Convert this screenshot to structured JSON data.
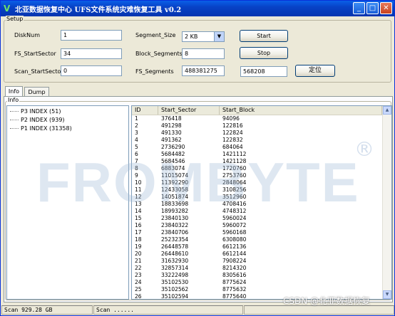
{
  "window": {
    "title": "北亚数据恢复中心 UFS文件系统灾难恢复工具 v0.2",
    "minimize": "_",
    "maximize": "□",
    "close": "✕"
  },
  "setup": {
    "group_label": "Setup",
    "disknum_label": "DiskNum",
    "disknum_value": "1",
    "fs_startsector_label": "FS_StartSector",
    "fs_startsector_value": "34",
    "scan_startsector_label": "Scan_StartSector",
    "scan_startsector_value": "0",
    "segment_size_label": "Segment_Size",
    "segment_size_value": "2 KB",
    "block_segments_label": "Block_Segments",
    "block_segments_value": "8",
    "fs_segments_label": "FS_Segments",
    "fs_segments_value": "488381275",
    "locate_input_value": "568208",
    "start_button": "Start",
    "stop_button": "Stop",
    "locate_button": "定位"
  },
  "tabs": [
    {
      "label": "Info",
      "active": true
    },
    {
      "label": "Dump",
      "active": false
    }
  ],
  "info_group_label": "Info",
  "tree": [
    "P3 INDEX (51)",
    "P2 INDEX (939)",
    "P1 INDEX (31358)"
  ],
  "list": {
    "columns": [
      "ID",
      "Start_Sector",
      "Start_Block"
    ],
    "rows": [
      [
        "1",
        "376418",
        "94096"
      ],
      [
        "2",
        "491298",
        "122816"
      ],
      [
        "3",
        "491330",
        "122824"
      ],
      [
        "4",
        "491362",
        "122832"
      ],
      [
        "5",
        "2736290",
        "684064"
      ],
      [
        "6",
        "5684482",
        "1421112"
      ],
      [
        "7",
        "5684546",
        "1421128"
      ],
      [
        "8",
        "6883074",
        "1720760"
      ],
      [
        "9",
        "11015074",
        "2753760"
      ],
      [
        "10",
        "11392290",
        "2848064"
      ],
      [
        "11",
        "12433058",
        "3108256"
      ],
      [
        "12",
        "14051874",
        "3512960"
      ],
      [
        "13",
        "18833698",
        "4708416"
      ],
      [
        "14",
        "18993282",
        "4748312"
      ],
      [
        "15",
        "23840130",
        "5960024"
      ],
      [
        "16",
        "23840322",
        "5960072"
      ],
      [
        "17",
        "23840706",
        "5960168"
      ],
      [
        "18",
        "25232354",
        "6308080"
      ],
      [
        "19",
        "26448578",
        "6612136"
      ],
      [
        "20",
        "26448610",
        "6612144"
      ],
      [
        "21",
        "31632930",
        "7908224"
      ],
      [
        "22",
        "32857314",
        "8214320"
      ],
      [
        "23",
        "33222498",
        "8305616"
      ],
      [
        "24",
        "35102530",
        "8775624"
      ],
      [
        "25",
        "35102562",
        "8775632"
      ],
      [
        "26",
        "35102594",
        "8775640"
      ]
    ]
  },
  "status": {
    "left": "Scan 929.28 GB",
    "right": "Scan ......"
  },
  "watermark": {
    "text": "FROMBYTE",
    "reg": "®"
  },
  "credit": "CSDN @北亚数据恢复"
}
